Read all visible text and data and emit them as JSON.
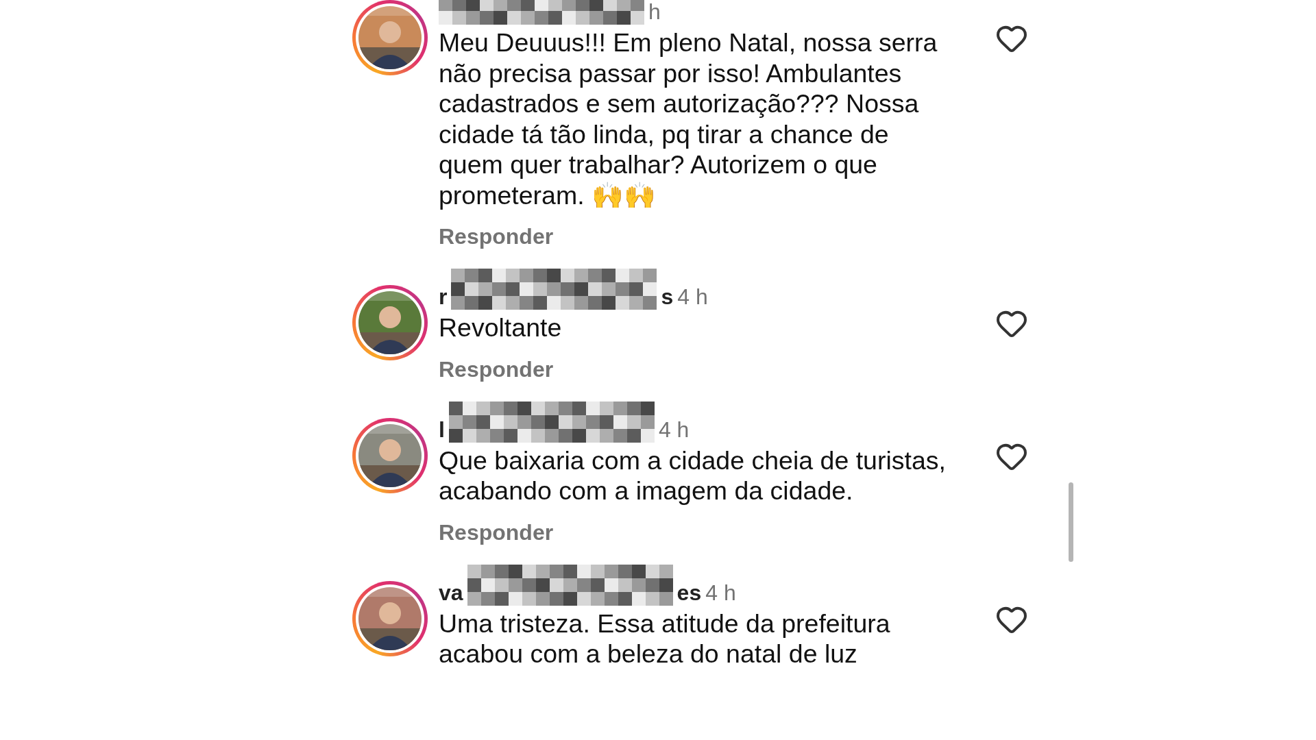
{
  "comments": [
    {
      "time": "h",
      "text": "Meu Deuuus!!! Em pleno Natal, nossa serra não precisa passar por isso! Ambulantes cadastrados e sem autorização??? Nossa cidade tá tão linda, pq tirar a chance de quem quer trabalhar? Autorizem o que prometeram. 🙌🙌",
      "reply": "Responder",
      "liked": false
    },
    {
      "username_start": "r",
      "username_end": "s",
      "time": "4 h",
      "text": "Revoltante",
      "reply": "Responder",
      "liked": false
    },
    {
      "username_start": "l",
      "time": "4 h",
      "text": "Que baixaria com a cidade cheia de turistas, acabando com a imagem da cidade.",
      "reply": "Responder",
      "liked": false
    },
    {
      "username_start": "va",
      "username_end": "es",
      "time": "4 h",
      "text": "Uma tristeza. Essa atitude da prefeitura acabou com a beleza do natal de luz",
      "liked": false
    }
  ]
}
